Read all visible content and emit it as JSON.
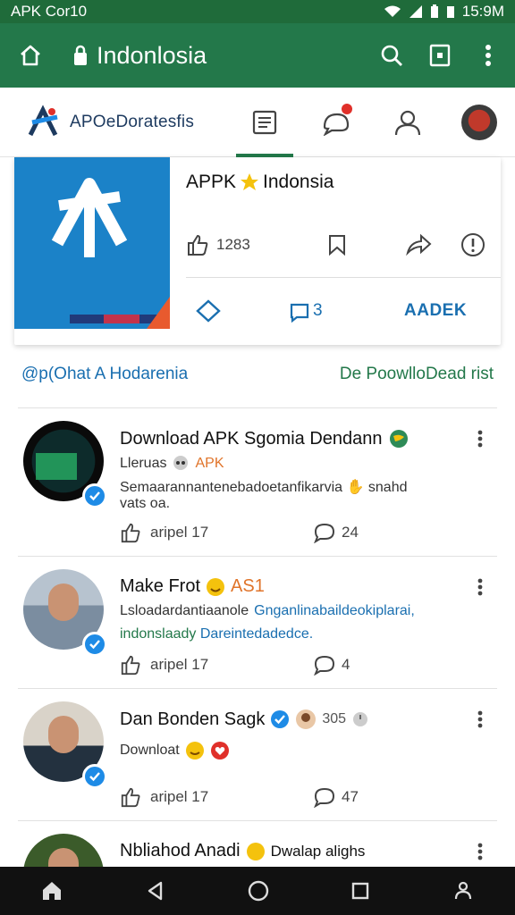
{
  "status": {
    "carrier": "APK Cor10",
    "time": "15:9M"
  },
  "appbar": {
    "title": "Indonlosia"
  },
  "header": {
    "brand": "APOeDoratesfis"
  },
  "card": {
    "title": "APPK",
    "title_tail": "Indonsia",
    "likes": "1283",
    "count_b": "3",
    "action_label": "AADEK"
  },
  "links": {
    "left": "@p(Ohat A Hodarenia",
    "right": "De PoowlloDead rist"
  },
  "posts": [
    {
      "name": "Download APK Sgomia Dendann",
      "line2_a": "Lleruas",
      "line2_b": "APK",
      "line3": "Semaarannantenebadoetanfikarvia",
      "line3_tail": "snahd",
      "line3b": "vats oa.",
      "likes": "aripel 17",
      "comments": "24"
    },
    {
      "name": "Make Frot",
      "name_tail": "AS1",
      "line2_a": "Lsloadardantiaanole",
      "line2_b": "Gnganlinabaildeokiplarai,",
      "line3_a": "indonslaady",
      "line3_b": "Dareintedadedce.",
      "likes": "aripel 17",
      "comments": "4"
    },
    {
      "name": "Dan Bonden Sagk",
      "name_tail": "305",
      "line2_a": "Downloat",
      "likes": "aripel 17",
      "comments": "47"
    },
    {
      "name": "Nbliahod Anadi",
      "name_tail": "Dwalap alighs"
    }
  ]
}
